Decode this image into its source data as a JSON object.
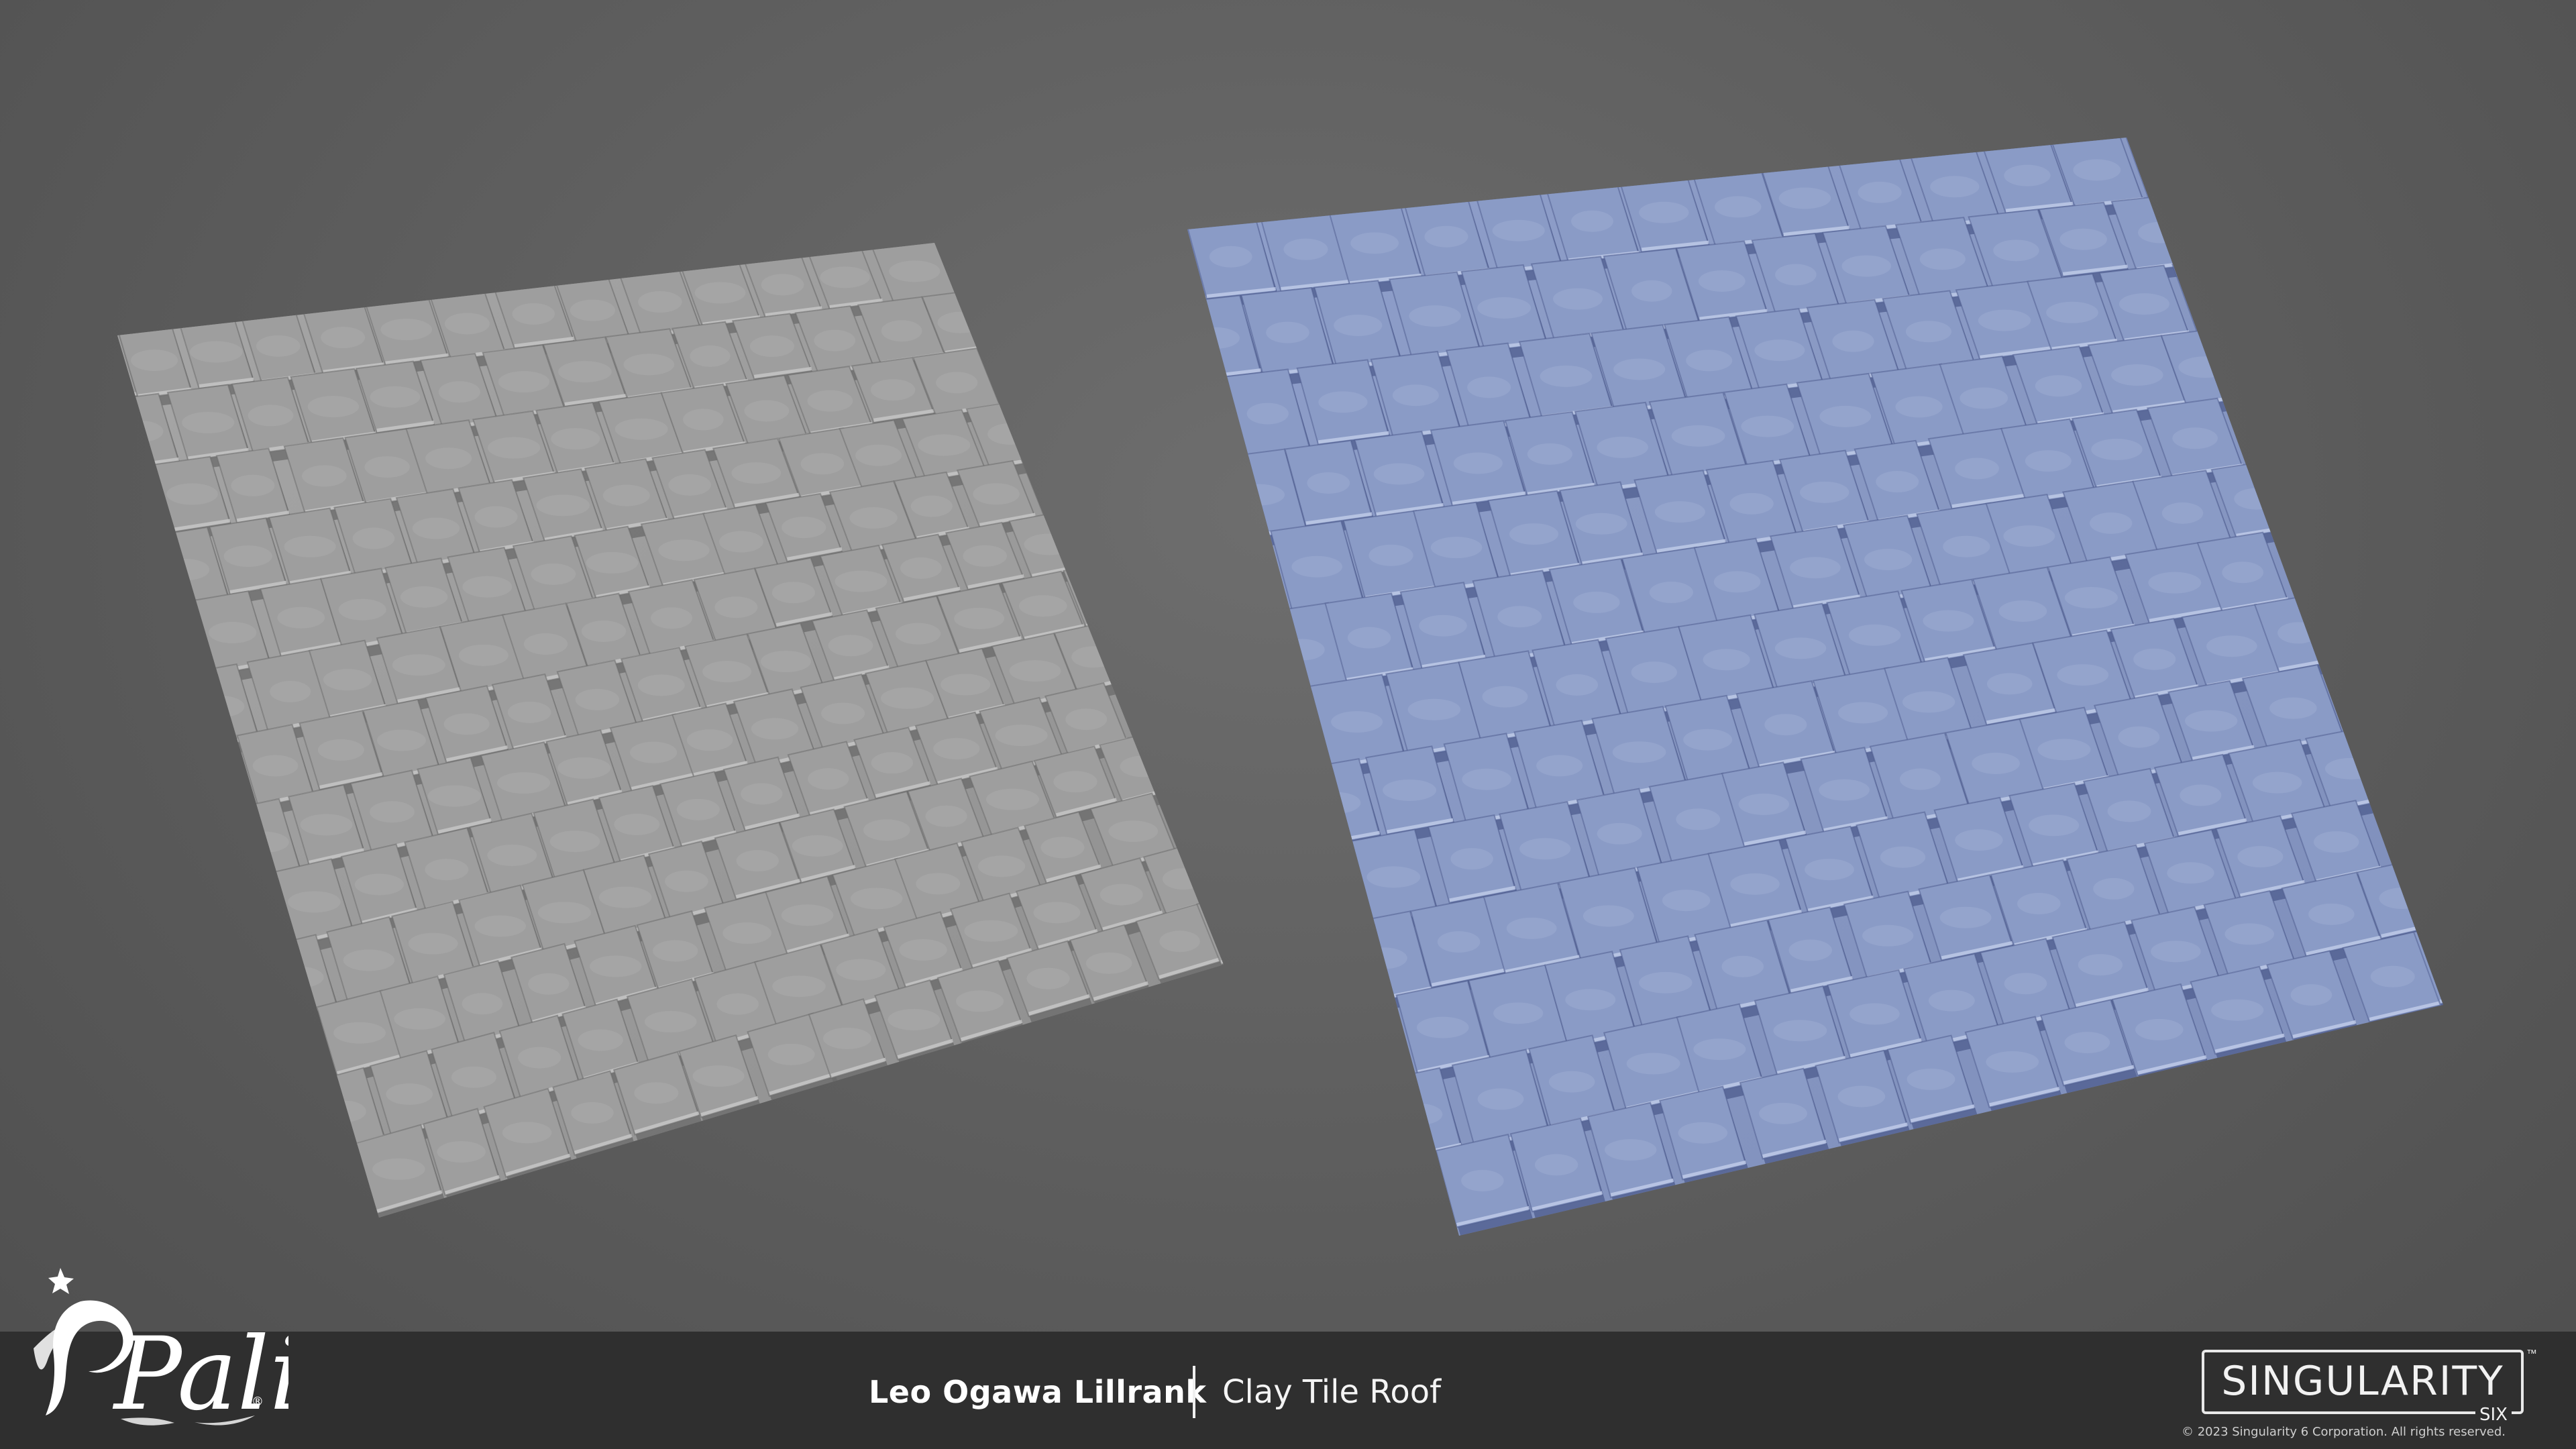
{
  "artwork": {
    "left_panel": {
      "label": "grayscale-sculpt",
      "base_color": "#9e9e9e",
      "shade_color": "#6a6a6a",
      "highlight_color": "#c8c8c8"
    },
    "right_panel": {
      "label": "tinted-sculpt",
      "base_color": "#8a9bc6",
      "shade_color": "#4d5c8e",
      "highlight_color": "#c2cdea"
    }
  },
  "logo": {
    "text": "Palia",
    "registered": "®",
    "icon": "palia-logo-icon"
  },
  "credits": {
    "artist": "Leo Ogawa Lillrank",
    "title": "Clay Tile Roof"
  },
  "studio": {
    "name": "SINGULARITY",
    "sub": "SIX",
    "tm": "™",
    "copyright": "© 2023 Singularity 6 Corporation. All rights reserved."
  },
  "colors": {
    "background": "#5f5f5f",
    "footer": "#2f2f2f",
    "text": "#ffffff"
  }
}
